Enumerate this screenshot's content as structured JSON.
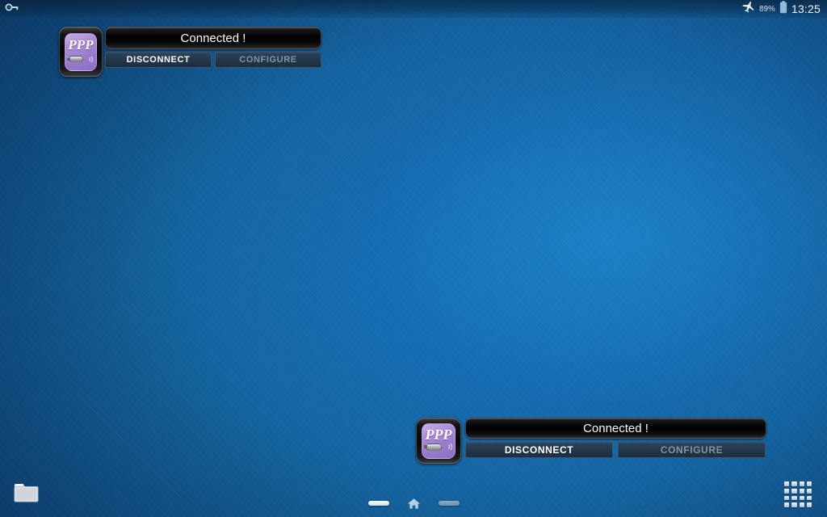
{
  "statusbar": {
    "notification_icon": "vpn-key-icon",
    "airplane_icon": "airplane-mode-icon",
    "battery_percent": "89%",
    "battery_icon": "battery-icon",
    "time": "13:25"
  },
  "widgets": [
    {
      "id": "widget-top",
      "app_label": "PPP",
      "icon_name": "ppp-widget-icon",
      "status_text": "Connected !",
      "buttons": [
        {
          "label": "DISCONNECT",
          "state": "enabled"
        },
        {
          "label": "CONFIGURE",
          "state": "disabled"
        }
      ]
    },
    {
      "id": "widget-bottom",
      "app_label": "PPP",
      "icon_name": "ppp-widget-icon",
      "status_text": "Connected !",
      "buttons": [
        {
          "label": "DISCONNECT",
          "state": "enabled"
        },
        {
          "label": "CONFIGURE",
          "state": "disabled"
        }
      ]
    }
  ],
  "desktop": {
    "folder_icon": "folder-icon",
    "app_drawer_icon": "app-drawer-grid-icon"
  },
  "navbar": {
    "back_icon": "back-dash-icon",
    "home_icon": "home-icon",
    "recents_icon": "recents-dash-icon"
  },
  "colors": {
    "wallpaper_light": "#1673b5",
    "wallpaper_dark": "#0c3a69",
    "icon_purple": "#9a7cce",
    "button_fill": "#24394d",
    "status_bar_black": "#000000",
    "disabled_text": "#7f95a8"
  }
}
